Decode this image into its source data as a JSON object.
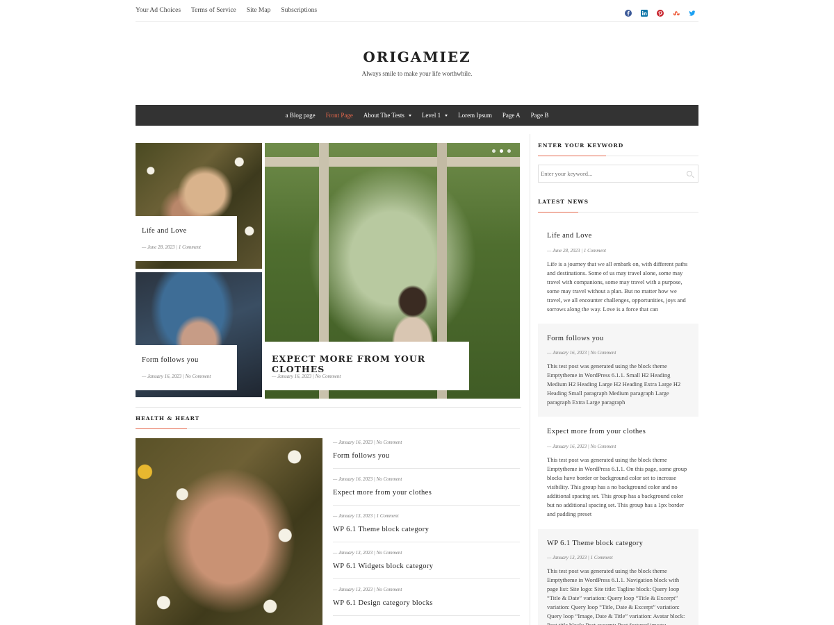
{
  "topbar": {
    "links": [
      "Your Ad Choices",
      "Terms of Service",
      "Site Map",
      "Subscriptions"
    ],
    "social": [
      {
        "icon": "facebook-icon",
        "color": "#3b5998"
      },
      {
        "icon": "linkedin-icon",
        "color": "#0e76a8"
      },
      {
        "icon": "pinterest-icon",
        "color": "#c8232c"
      },
      {
        "icon": "stumbleupon-icon",
        "color": "#eb4924"
      },
      {
        "icon": "twitter-icon",
        "color": "#1da1f2"
      }
    ]
  },
  "brand": {
    "title": "ORIGAMIEZ",
    "tagline": "Always smile to make your life worthwhile."
  },
  "nav": {
    "items": [
      "a Blog page",
      "Front Page",
      "About The Tests",
      "Level 1",
      "Lorem Ipsum",
      "Page A",
      "Page B"
    ],
    "active": "Front Page",
    "accent": "#e5674b"
  },
  "featured": {
    "small": [
      {
        "title": "Life and Love",
        "meta": "— June 28, 2023 | 1 Comment"
      },
      {
        "title": "Form follows you",
        "meta": "— January 16, 2023 | No Comment"
      }
    ],
    "main": {
      "title": "EXPECT MORE FROM YOUR CLOTHES",
      "meta": "— January 16, 2023 | No Comment"
    }
  },
  "health": {
    "heading": "HEALTH & HEART",
    "items": [
      {
        "meta": "— January 16, 2023 | No Comment",
        "title": "Form follows you"
      },
      {
        "meta": "— January 16, 2023 | No Comment",
        "title": "Expect more from your clothes"
      },
      {
        "meta": "— January 13, 2023 | 1 Comment",
        "title": "WP 6.1 Theme block category"
      },
      {
        "meta": "— January 13, 2023 | No Comment",
        "title": "WP 6.1 Widgets block category"
      },
      {
        "meta": "— January 13, 2023 | No Comment",
        "title": "WP 6.1 Design category blocks"
      }
    ]
  },
  "sidebar": {
    "search_heading": "ENTER YOUR KEYWORD",
    "search_placeholder": "Enter your keyword...",
    "latest_heading": "LATEST NEWS",
    "posts": [
      {
        "title": "Life and Love",
        "meta": "— June 28, 2023 | 1 Comment",
        "excerpt": "Life is a journey that we all embark on, with different paths and destinations. Some of us may travel alone, some may travel with companions, some may travel with a purpose, some may travel without a plan. But no matter how we travel, we all encounter challenges, opportunities, joys and sorrows along the way. Love is a force that can"
      },
      {
        "title": "Form follows you",
        "meta": "— January 16, 2023 | No Comment",
        "excerpt": "This test post was generated using the block theme Emptytheme in WordPress 6.1.1. Small H2 Heading Medium H2 Heading Large H2 Heading Extra Large H2 Heading Small paragraph Medium paragraph Large paragraph Extra Large paragraph"
      },
      {
        "title": "Expect more from your clothes",
        "meta": "— January 16, 2023 | No Comment",
        "excerpt": "This test post was generated using the block theme Emptytheme in WordPress 6.1.1. On this page, some group blocks have border or background color set to increase visibility. This group has a no background color and no additional spacing set. This group has a background color but no additional spacing set. This group has a 1px border and padding preset"
      },
      {
        "title": "WP 6.1 Theme block category",
        "meta": "— January 13, 2023 | 1 Comment",
        "excerpt": "This test post was generated using the block theme Emptytheme in WordPress 6.1.1. Navigation block with page list: Site logo: Site title: Tagline block: Query loop “Title & Date” variation: Query loop “Title & Excerpt” variation: Query loop “Title, Date & Excerpt” variation: Query loop “Image, Date & Title” variation: Avatar block: Post title block: Post excerpt: Post featured image:"
      }
    ]
  }
}
